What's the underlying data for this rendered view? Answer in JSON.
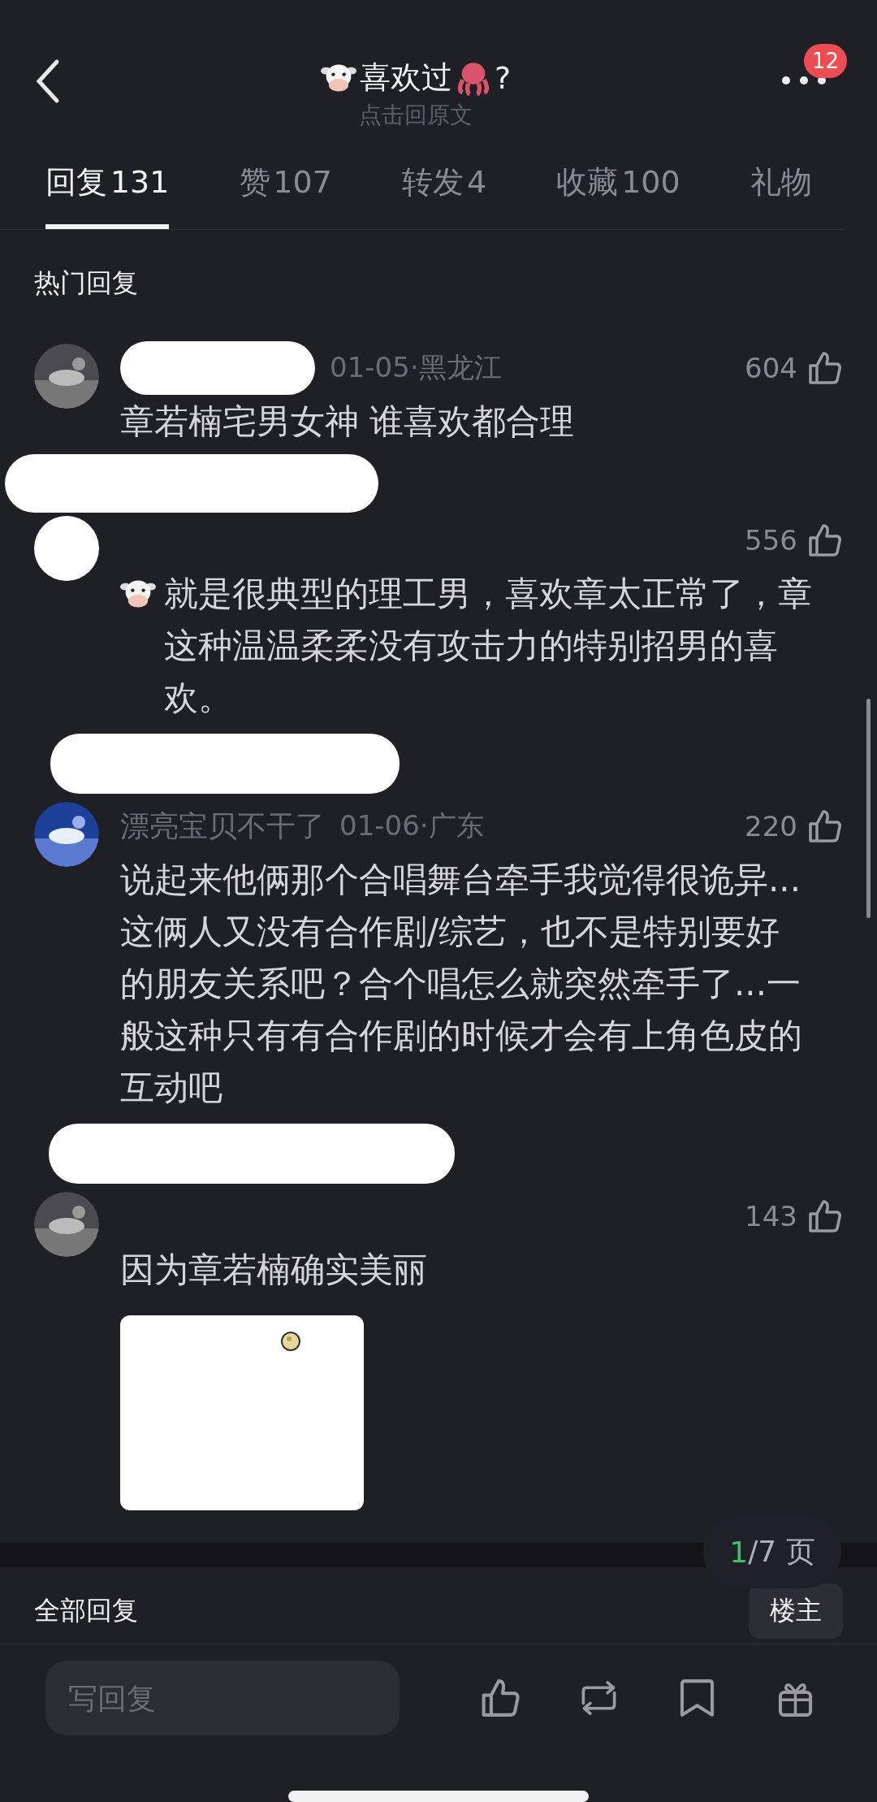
{
  "header": {
    "title": "喜欢过",
    "title_suffix": "?",
    "subtitle": "点击回原文",
    "badge": "12"
  },
  "tabs": [
    {
      "label": "回复",
      "count": "131",
      "selected": true
    },
    {
      "label": "赞",
      "count": "107",
      "selected": false
    },
    {
      "label": "转发",
      "count": "4",
      "selected": false
    },
    {
      "label": "收藏",
      "count": "100",
      "selected": false
    },
    {
      "label": "礼物",
      "selected": false
    }
  ],
  "hot_section": {
    "title": "热门回复"
  },
  "comments": [
    {
      "meta": "01-05·黑龙江",
      "likes": "604",
      "text": "章若楠宅男女神 谁喜欢都合理",
      "cow_icon": false
    },
    {
      "likes": "556",
      "text": "就是很典型的理工男，喜欢章太正常了，章这种温温柔柔没有攻击力的特别招男的喜欢。",
      "cow_icon": true
    },
    {
      "name": "漂亮宝贝不干了",
      "meta": "01-06·广东",
      "likes": "220",
      "text": "说起来他俩那个合唱舞台牵手我觉得很诡异...这俩人又没有合作剧/综艺，也不是特别要好的朋友关系吧？合个唱怎么就突然牵手了...一般这种只有有合作剧的时候才会有上角色皮的互动吧",
      "cow_icon": false
    },
    {
      "likes": "143",
      "text": "因为章若楠确实美丽",
      "cow_icon": false
    }
  ],
  "pager": {
    "current": "1",
    "total": "/7 页"
  },
  "all_section": {
    "title": "全部回复",
    "filter": "楼主"
  },
  "composer": {
    "placeholder": "写回复"
  }
}
